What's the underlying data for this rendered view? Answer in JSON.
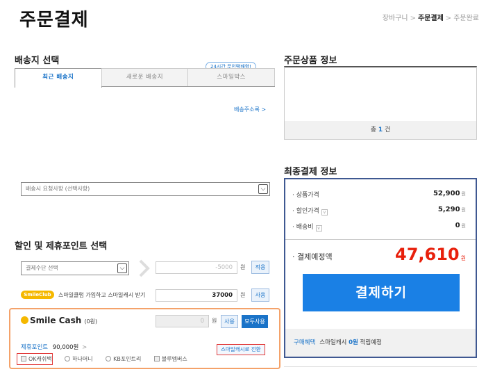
{
  "header": {
    "title": "주문결제",
    "breadcrumb": {
      "step1": "장바구니",
      "step2": "주문결제",
      "step3": "주문완료",
      "sep": ">"
    }
  },
  "shipping": {
    "title": "배송지 선택",
    "tabs": [
      "최근 배송지",
      "새로운 배송지",
      "스마일박스"
    ],
    "badge": "24시간 무인택배함!",
    "address_list_link": "배송주소록 >",
    "request_select": "배송시 요청사항 (선택사항)"
  },
  "discount": {
    "title": "할인 및 제휴포인트 선택",
    "coupon_select": "결제수단 선택",
    "coupon_input": "-5000",
    "unit": "원",
    "apply_label": "적용",
    "smileclub_logo": "SmileClub",
    "smileclub_text": "스마일클럽 가입하고 스마일캐시 받기",
    "smileclub_value": "37000",
    "use_label": "사용",
    "smilecash_logo": "Smile Cash",
    "smilecash_balance": "(0원)",
    "smilecash_input": "0",
    "use_all_label": "모두사용",
    "partner_point_label": "제휴포인트",
    "partner_point_value": "90,000원",
    "partner_arrow": ">",
    "convert_label": "스마일캐시로 전환",
    "options": [
      "OK캐쉬백",
      "하나머니",
      "KB포인트리",
      "블루멤버스"
    ]
  },
  "order_items": {
    "title": "주문상품 정보",
    "total_prefix": "총",
    "total_count": "1",
    "total_suffix": "건"
  },
  "final": {
    "title": "최종결제 정보",
    "rows": [
      {
        "label": "· 상품가격",
        "value": "52,900",
        "unit": "원"
      },
      {
        "label": "· 할인가격",
        "value": "5,290",
        "unit": "원"
      },
      {
        "label": "· 배송비",
        "value": "0",
        "unit": "원"
      }
    ],
    "expected_label": "· 결제예정액",
    "expected_amount": "47,610",
    "expected_unit": "원",
    "pay_button": "결제하기",
    "benefit_label": "구매혜택",
    "benefit_text": "스마일캐시",
    "benefit_amount": "0원",
    "benefit_suffix": "적립예정"
  },
  "colors": {
    "accent": "#1a73c8",
    "pay_button": "#1a80e5",
    "summary_border": "#3f5891",
    "amount_red": "#e8200c",
    "smile_yellow": "#f5b800",
    "highlight_orange": "#f4a26a",
    "highlight_red": "#e23b3b"
  }
}
